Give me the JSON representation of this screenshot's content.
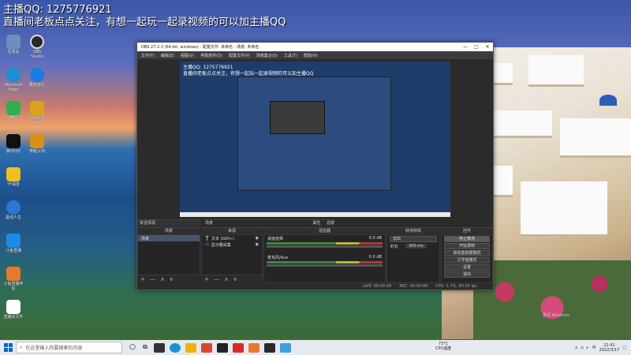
{
  "overlay": {
    "line1": "主播QQ: 1275776921",
    "line2": "直播间老板点点关注，有想一起玩一起录视频的可以加主播QQ"
  },
  "desktop_icons": [
    {
      "label": "回收站",
      "color": "#6b8fbf"
    },
    {
      "label": "OBS Studio",
      "color": "#2a2a2a"
    },
    {
      "label": "Microsoft Edge",
      "color": "#1b8fd6"
    },
    {
      "label": "酷狗音乐",
      "color": "#1a7ae6"
    },
    {
      "label": "微信",
      "color": "#2bb24c"
    },
    {
      "label": "CF活动助手",
      "color": "#d9a417"
    },
    {
      "label": "腾讯QQ",
      "color": "#111111"
    },
    {
      "label": "穿越火线",
      "color": "#d98f17"
    },
    {
      "label": "YY语音",
      "color": "#f0c020"
    },
    {
      "label": "驱动人生",
      "color": "#2a78d0"
    },
    {
      "label": "斗鱼直播",
      "color": "#1e8ae6"
    },
    {
      "label": "斗鱼直播伴侣",
      "color": "#e8782a"
    },
    {
      "label": "直播间文件",
      "color": "#ffffff"
    }
  ],
  "obs": {
    "title": "OBS 27.2.3 (64-bit, windows) - 配置文件: 未命名 - 场景: 未命名",
    "window_controls": [
      "—",
      "□",
      "✕"
    ],
    "menu": [
      "文件(F)",
      "编辑(E)",
      "视图(V)",
      "停靠部件(D)",
      "配置文件(P)",
      "场景集合(S)",
      "工具(T)",
      "帮助(H)"
    ],
    "preview_text1": "主播QQ: 1275776921",
    "preview_text2": "直播间老板点点关注，有想一起玩一起录视频的可以加主播QQ",
    "no_source": "未选择源",
    "props_btn": "属性",
    "filter_btn": "滤镜",
    "docks": {
      "scenes": {
        "title": "场景",
        "items": [
          "场景"
        ]
      },
      "sources": {
        "title": "来源",
        "items": [
          "文本 (GDI+)",
          "显示器采集"
        ]
      },
      "mixer": {
        "title": "混音器",
        "channels": [
          {
            "name": "桌面音频",
            "db": "0.0 dB"
          },
          {
            "name": "麦克风/Aux",
            "db": "0.0 dB"
          }
        ]
      },
      "transitions": {
        "title": "转场特效",
        "mode": "淡出",
        "duration_label": "时长",
        "duration": "300 ms"
      },
      "controls": {
        "title": "控件",
        "buttons": [
          "停止推流",
          "开始录制",
          "启动虚拟摄像机",
          "工作室模式",
          "设置",
          "退出"
        ]
      }
    },
    "footer_icons": "+ — ∧ ∨",
    "status": {
      "live": "LIVE: 00:00:00",
      "rec": "REC: 00:00:00",
      "cpu": "CPU: 1.7%, 60.00 fps"
    }
  },
  "taskbar": {
    "search_placeholder": "在这里输入你要搜索的内容",
    "apps": [
      {
        "color": "#333"
      },
      {
        "color": "#1b8fd6"
      },
      {
        "color": "#f0b400"
      },
      {
        "color": "#d9482a"
      },
      {
        "color": "#222"
      },
      {
        "color": "#d92a2a"
      },
      {
        "color": "#e87a2a"
      },
      {
        "color": "#2a2a2a"
      },
      {
        "color": "#3aa0e0"
      }
    ],
    "weather_temp": "73°C",
    "weather_desc": "CPU温度",
    "time": "21:41",
    "date": "2022/3/17"
  },
  "watermark": "激活 Windows"
}
